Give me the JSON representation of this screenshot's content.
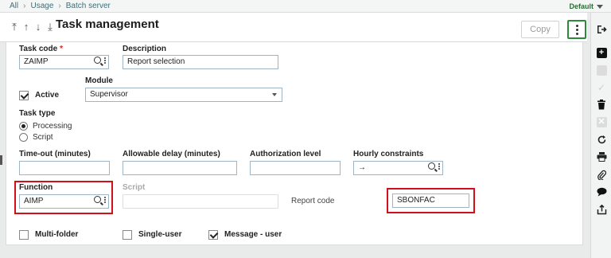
{
  "breadcrumbs": [
    "All",
    "Usage",
    "Batch server"
  ],
  "top_right": {
    "default_label": "Default"
  },
  "header": {
    "title": "Task management",
    "copy_label": "Copy"
  },
  "form": {
    "task_code": {
      "label": "Task code",
      "required_mark": "*",
      "value": "ZAIMP"
    },
    "description": {
      "label": "Description",
      "value": "Report selection"
    },
    "module": {
      "label": "Module",
      "value": "Supervisor"
    },
    "active": {
      "label": "Active",
      "checked": true
    },
    "task_type": {
      "label": "Task type",
      "options": [
        "Processing",
        "Script"
      ],
      "selected": "Processing"
    },
    "timeout": {
      "label": "Time-out (minutes)",
      "value": ""
    },
    "allowable_delay": {
      "label": "Allowable delay (minutes)",
      "value": ""
    },
    "authorization_level": {
      "label": "Authorization level",
      "value": ""
    },
    "hourly_constraints": {
      "label": "Hourly constraints",
      "value": "→"
    },
    "function": {
      "label": "Function",
      "value": "AIMP"
    },
    "script": {
      "label": "Script",
      "value": ""
    },
    "report_code": {
      "label": "Report code",
      "value": "SBONFAC"
    },
    "multi_folder": {
      "label": "Multi-folder",
      "checked": false
    },
    "single_user": {
      "label": "Single-user",
      "checked": false
    },
    "message_user": {
      "label": "Message - user",
      "checked": true
    }
  },
  "right_toolbar": [
    "exit-icon",
    "add-icon",
    "cancel-icon",
    "save-icon",
    "delete-icon",
    "close-icon",
    "refresh-icon",
    "print-icon",
    "attach-icon",
    "comment-icon",
    "export-icon"
  ],
  "colors": {
    "accent_green": "#2c8a3d",
    "highlight_red": "#d0101a",
    "breadcrumb": "#3b6f7a"
  }
}
